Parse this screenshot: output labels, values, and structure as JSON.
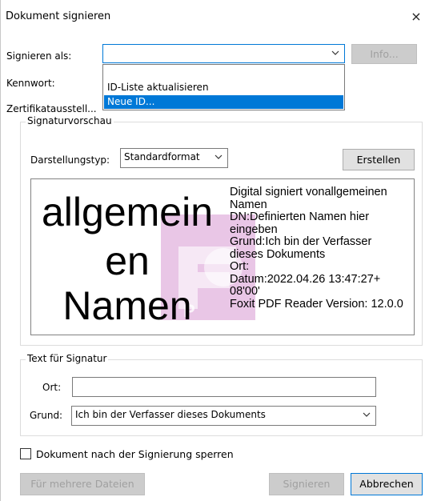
{
  "window": {
    "title": "Dokument signieren",
    "close_glyph": "×"
  },
  "sign_as": {
    "label": "Signieren als:",
    "value": "",
    "info_button": "Info...",
    "dropdown_options": [
      "ID-Liste aktualisieren",
      "Neue ID..."
    ],
    "highlighted_option": "Neue ID..."
  },
  "password": {
    "label": "Kennwort:"
  },
  "issuer": {
    "label": "Zertifikatausstell..."
  },
  "preview": {
    "group_title": "Signaturvorschau",
    "type_label": "Darstellungstyp:",
    "type_value": "Standardformat",
    "create_button": "Erstellen",
    "name_lines": [
      "allgemein",
      "en",
      "Namen"
    ],
    "info_lines": [
      "Digital signiert vonallgemeinen",
      "Namen",
      "DN:Definierten Namen hier",
      "eingeben",
      "Grund:Ich bin der Verfasser",
      "dieses Dokuments",
      "Ort:",
      "Datum:2022.04.26 13:47:27+",
      "08'00'",
      "Foxit PDF Reader Version: 12.0.0"
    ]
  },
  "text_group": {
    "title": "Text für Signatur",
    "location_label": "Ort:",
    "location_value": "",
    "reason_label": "Grund:",
    "reason_value": "Ich bin der Verfasser dieses Dokuments"
  },
  "lock": {
    "label": "Dokument nach der Signierung sperren",
    "checked": false
  },
  "footer": {
    "multi_files_button": "Für mehrere Dateien",
    "sign_button": "Signieren",
    "cancel_button": "Abbrechen"
  },
  "colors": {
    "accent": "#0078d7",
    "watermark_pink": "#e9c6e6",
    "watermark_purple": "#9b3d98"
  }
}
